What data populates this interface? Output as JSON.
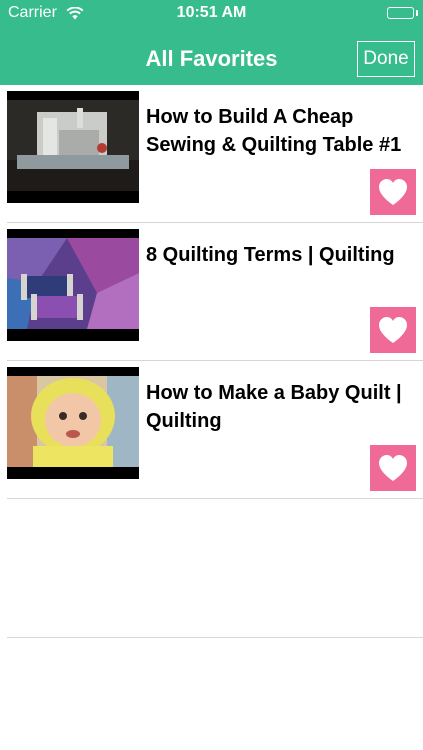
{
  "status_bar": {
    "carrier": "Carrier",
    "time": "10:51 AM"
  },
  "nav": {
    "title": "All Favorites",
    "done_label": "Done"
  },
  "colors": {
    "nav_background": "#37bc8e",
    "favorite_button": "#ef6a97"
  },
  "favorites": [
    {
      "title": "How to Build A Cheap Sewing & Quilting Table #1",
      "thumbnail": "sewing-machine-table",
      "icon": "heart-icon"
    },
    {
      "title": "8 Quilting Terms | Quilting",
      "thumbnail": "thread-spools-on-quilt",
      "icon": "heart-icon"
    },
    {
      "title": "How to Make a Baby Quilt | Quilting",
      "thumbnail": "baby-in-yellow-hood",
      "icon": "heart-icon"
    }
  ]
}
